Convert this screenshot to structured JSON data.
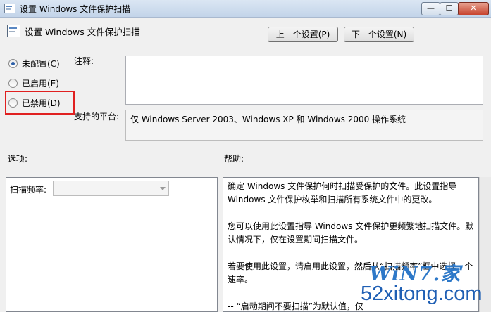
{
  "window": {
    "title": "设置 Windows 文件保护扫描",
    "min_glyph": "—",
    "max_glyph": "☐",
    "close_glyph": "✕"
  },
  "header": {
    "title": "设置 Windows 文件保护扫描",
    "prev_button": "上一个设置(P)",
    "next_button": "下一个设置(N)"
  },
  "state": {
    "options": [
      {
        "label": "未配置(C)",
        "selected": true
      },
      {
        "label": "已启用(E)",
        "selected": false
      },
      {
        "label": "已禁用(D)",
        "selected": false
      }
    ],
    "highlight_color": "#e02020"
  },
  "comment": {
    "label": "注释:",
    "value": ""
  },
  "platform": {
    "label": "支持的平台:",
    "value": "仅 Windows Server 2003、Windows XP 和 Windows 2000 操作系统"
  },
  "options_section": {
    "label": "选项:",
    "scan_frequency_label": "扫描频率:",
    "scan_frequency_value": ""
  },
  "help_section": {
    "label": "帮助:",
    "paragraphs": [
      "确定 Windows 文件保护何时扫描受保护的文件。此设置指导 Windows 文件保护枚举和扫描所有系统文件中的更改。",
      "您可以使用此设置指导 Windows 文件保护更频繁地扫描文件。默认情况下，仅在设置期间扫描文件。",
      "若要使用此设置，请启用此设置，然后从“扫描频率”框中选择一个速率。",
      "-- “启动期间不要扫描”为默认值，仅"
    ]
  },
  "watermark": {
    "top": "WiN7.家",
    "bottom": "52xitong.com"
  }
}
